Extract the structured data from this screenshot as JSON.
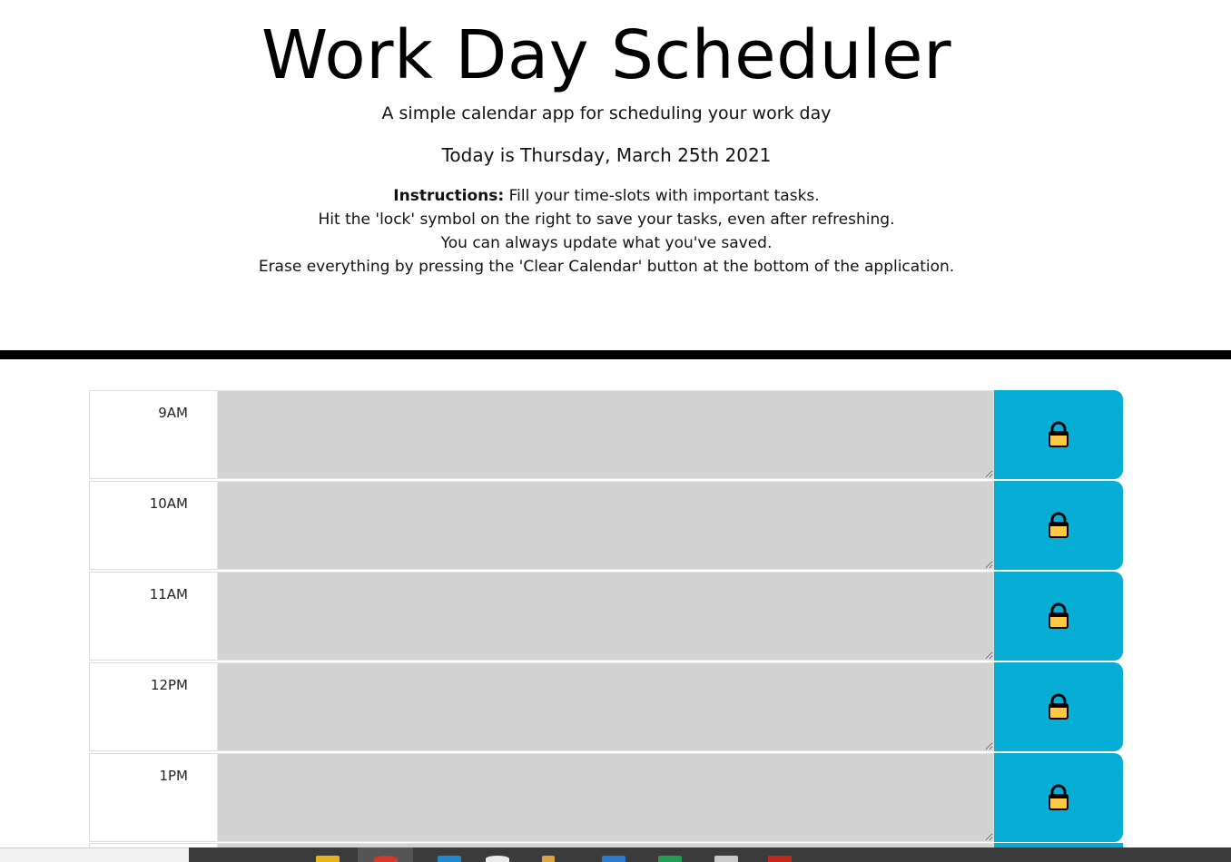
{
  "header": {
    "title": "Work Day Scheduler",
    "subtitle": "A simple calendar app for scheduling your work day",
    "today": "Today is Thursday, March 25th 2021",
    "instructions_label": "Instructions:",
    "instructions_line1": " Fill your time-slots with important tasks.",
    "instructions_line2": "Hit the 'lock' symbol on the right to save your tasks, even after refreshing.",
    "instructions_line3": "You can always update what you've saved.",
    "instructions_line4": "Erase everything by pressing the 'Clear Calendar' button at the bottom of the application."
  },
  "schedule": {
    "rows": [
      {
        "hour": "9AM",
        "task": ""
      },
      {
        "hour": "10AM",
        "task": ""
      },
      {
        "hour": "11AM",
        "task": ""
      },
      {
        "hour": "12PM",
        "task": ""
      },
      {
        "hour": "1PM",
        "task": ""
      }
    ],
    "save_icon": "lock-icon"
  },
  "colors": {
    "save_button": "#06aed5",
    "lock_body": "#ffc845",
    "task_past": "#d3d3d3",
    "divider": "#000000"
  },
  "taskbar": {
    "icons": [
      "search-icon",
      "file-explorer-icon",
      "chrome-icon",
      "vscode-icon",
      "app-icon",
      "paint-icon",
      "mail-icon",
      "sheets-icon",
      "notes-icon",
      "pdf-icon"
    ]
  }
}
